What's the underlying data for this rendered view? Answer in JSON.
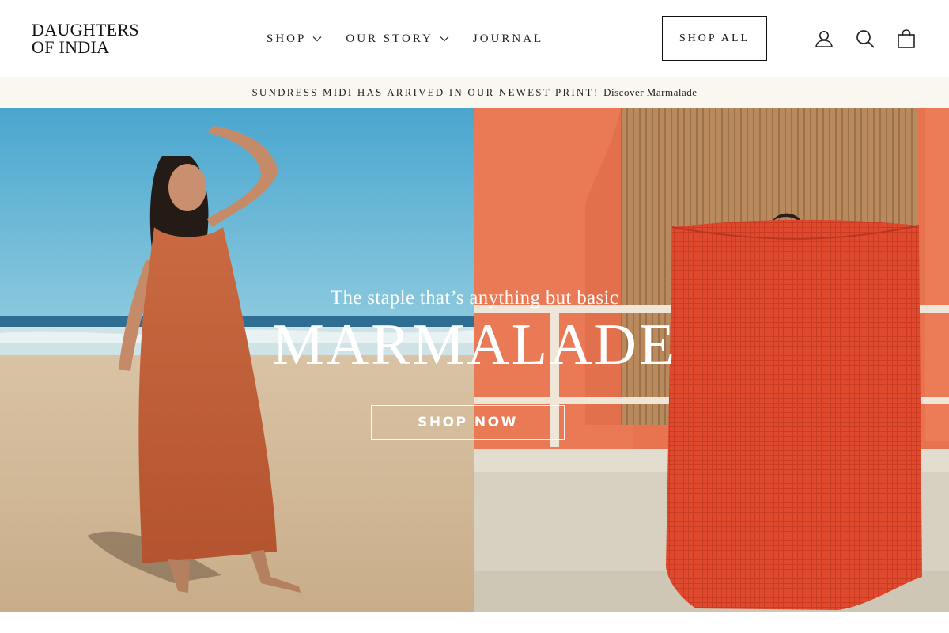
{
  "brand": {
    "logo_line1": "DAUGHTERS",
    "logo_line2": "OF INDIA"
  },
  "nav": {
    "items": [
      {
        "label": "SHOP",
        "has_dropdown": true
      },
      {
        "label": "OUR STORY",
        "has_dropdown": true
      },
      {
        "label": "JOURNAL",
        "has_dropdown": false
      }
    ],
    "shop_all_label": "SHOP ALL"
  },
  "header_icons": [
    "account-icon",
    "search-icon",
    "cart-bag-icon"
  ],
  "announcement": {
    "text": "SUNDRESS MIDI HAS ARRIVED IN OUR NEWEST PRINT!",
    "link_text": "Discover Marmalade"
  },
  "hero": {
    "tagline": "The staple that’s anything but basic",
    "headline": "MARMALADE",
    "cta_label": "SHOP NOW"
  },
  "colors": {
    "announcement_bg": "#faf6f0",
    "sky": "#5aaed0",
    "dress": "#c65a36",
    "wall": "#e8744f",
    "fabric": "#e0462c"
  }
}
